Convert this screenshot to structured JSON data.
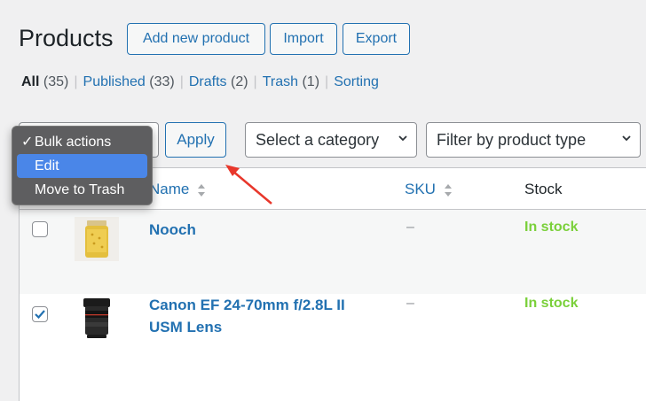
{
  "header": {
    "title": "Products",
    "add_new": "Add new product",
    "import": "Import",
    "export": "Export"
  },
  "views": {
    "all_label": "All",
    "all_count": "(35)",
    "published_label": "Published",
    "published_count": "(33)",
    "drafts_label": "Drafts",
    "drafts_count": "(2)",
    "trash_label": "Trash",
    "trash_count": "(1)",
    "sorting_label": "Sorting",
    "separator": "|"
  },
  "toolbar": {
    "apply": "Apply",
    "category_select": "Select a category",
    "type_select": "Filter by product type"
  },
  "bulk_menu": {
    "check_glyph": "✓",
    "items": [
      "Bulk actions",
      "Edit",
      "Move to Trash"
    ],
    "selected": "Bulk actions",
    "highlighted": "Edit"
  },
  "table": {
    "columns": [
      "Name",
      "SKU",
      "Stock"
    ],
    "rows": [
      {
        "name": "Nooch",
        "sku": "–",
        "stock": "In stock",
        "checked": false,
        "icon": "jar-image"
      },
      {
        "name_line1": "Canon EF 24-70mm f/2.8L II",
        "name_line2": "USM Lens",
        "sku": "–",
        "stock": "In stock",
        "checked": true,
        "icon": "camera-lens-image"
      }
    ]
  },
  "colors": {
    "link": "#2271b1",
    "in_stock": "#7ad03a",
    "menu_bg": "#5e5e60",
    "menu_highlight": "#4a86e8",
    "annotation_arrow": "#e8372b"
  }
}
